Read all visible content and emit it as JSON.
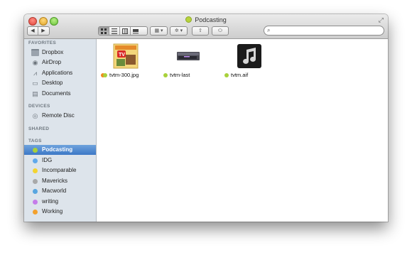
{
  "window": {
    "title": "Podcasting",
    "title_tag_color": "#b7d33c"
  },
  "toolbar": {
    "back_label": "◀",
    "forward_label": "▶",
    "view_icons": [
      "icon-view-icon",
      "list-view-icon",
      "column-view-icon",
      "coverflow-view-icon"
    ],
    "arrange_label": "▦ ▾",
    "action_label": "✲ ▾",
    "share_label": "⇧",
    "tag_label": "⬭",
    "search_placeholder": ""
  },
  "sidebar": {
    "favorites_header": "FAVORITES",
    "favorites": [
      {
        "label": "Dropbox",
        "icon": "folder-icon"
      },
      {
        "label": "AirDrop",
        "icon": "airdrop-icon"
      },
      {
        "label": "Applications",
        "icon": "applications-icon"
      },
      {
        "label": "Desktop",
        "icon": "desktop-icon"
      },
      {
        "label": "Documents",
        "icon": "documents-icon"
      }
    ],
    "devices_header": "DEVICES",
    "devices": [
      {
        "label": "Remote Disc",
        "icon": "disc-icon"
      }
    ],
    "shared_header": "SHARED",
    "tags_header": "TAGS",
    "tags": [
      {
        "label": "Podcasting",
        "color": "#a8d13a",
        "selected": true
      },
      {
        "label": "IDG",
        "color": "#5fa9ec"
      },
      {
        "label": "Incomparable",
        "color": "#f3d431"
      },
      {
        "label": "Mavericks",
        "color": "#a9a9a9"
      },
      {
        "label": "Macworld",
        "color": "#58a6e0"
      },
      {
        "label": "writing",
        "color": "#c57ce9"
      },
      {
        "label": "Working",
        "color": "#f3a12d"
      }
    ]
  },
  "files": [
    {
      "name": "tvtm-300.jpg",
      "tag_colors": [
        "#f08a1e",
        "#a8d13a"
      ],
      "icon": "image-thumbnail-icon"
    },
    {
      "name": "tvtm-last",
      "tag_colors": [
        "#a8d13a"
      ],
      "icon": "device-thumbnail-icon"
    },
    {
      "name": "tvtm.aif",
      "tag_colors": [
        "#a8d13a"
      ],
      "icon": "music-file-icon"
    }
  ]
}
